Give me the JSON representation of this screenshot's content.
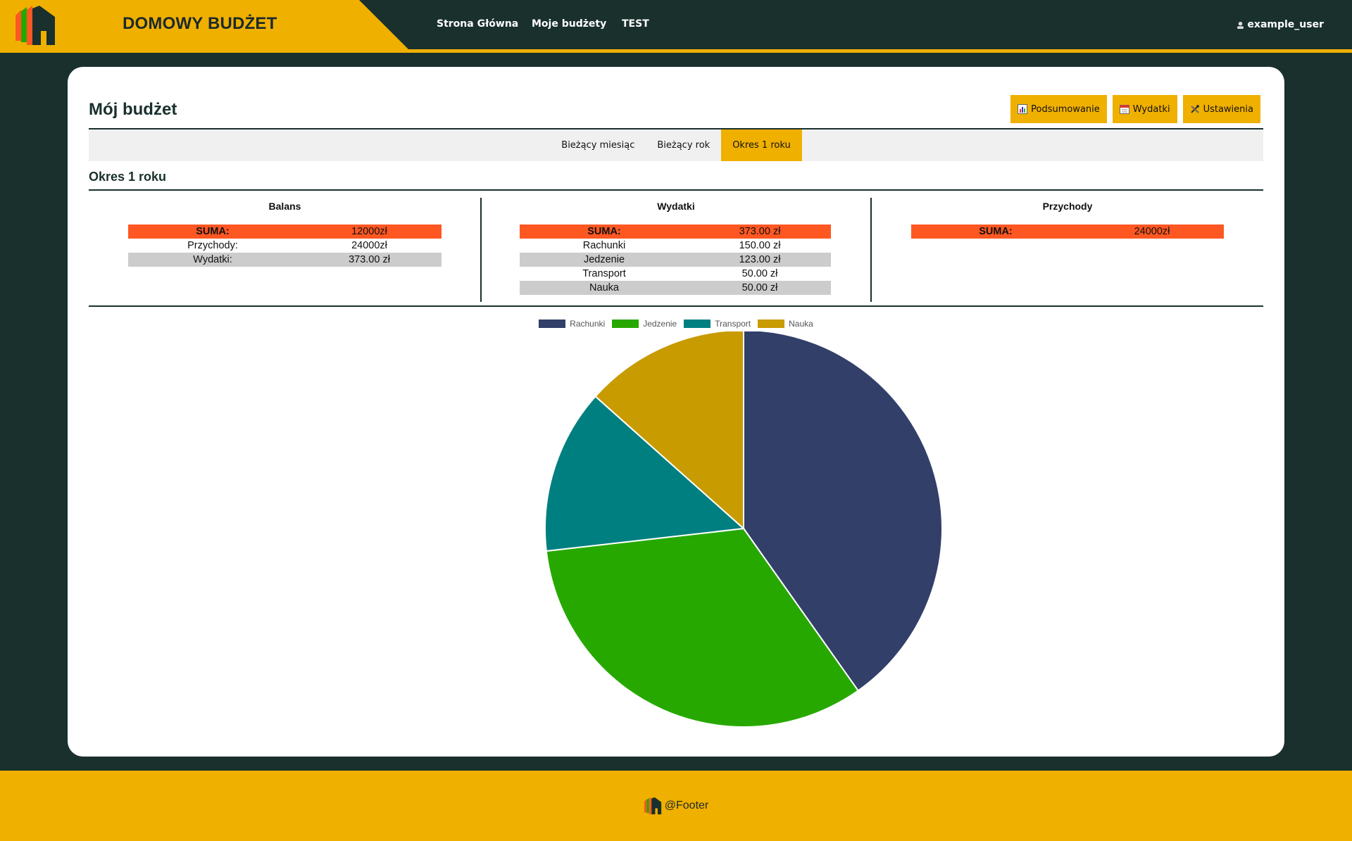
{
  "header": {
    "brand": "DOMOWY BUDŻET",
    "nav": [
      "Strona Główna",
      "Moje budżety",
      "TEST"
    ],
    "user": "example_user"
  },
  "page": {
    "title": "Mój budżet",
    "buttons": {
      "summary": "Podsumowanie",
      "expenses": "Wydatki",
      "settings": "Ustawienia"
    },
    "periods": [
      "Bieżący miesiąc",
      "Bieżący rok",
      "Okres 1 roku"
    ],
    "active_period": "Okres 1 roku",
    "section_title": "Okres 1 roku"
  },
  "balance": {
    "heading": "Balans",
    "rows": [
      {
        "label": "SUMA:",
        "value": "12000zł"
      },
      {
        "label": "Przychody:",
        "value": "24000zł"
      },
      {
        "label": "Wydatki:",
        "value": "373.00 zł"
      }
    ]
  },
  "expenses": {
    "heading": "Wydatki",
    "rows": [
      {
        "label": "SUMA:",
        "value": "373.00 zł"
      },
      {
        "label": "Rachunki",
        "value": "150.00 zł"
      },
      {
        "label": "Jedzenie",
        "value": "123.00 zł"
      },
      {
        "label": "Transport",
        "value": "50.00 zł"
      },
      {
        "label": "Nauka",
        "value": "50.00 zł"
      }
    ]
  },
  "income": {
    "heading": "Przychody",
    "rows": [
      {
        "label": "SUMA:",
        "value": "24000zł"
      }
    ]
  },
  "chart_data": {
    "type": "pie",
    "categories": [
      "Rachunki",
      "Jedzenie",
      "Transport",
      "Nauka"
    ],
    "values": [
      150,
      123,
      50,
      50
    ],
    "colors": [
      "#313f69",
      "#27a800",
      "#007f80",
      "#c89b00"
    ],
    "legend": "top"
  },
  "footer": {
    "text": "@Footer"
  },
  "colors": {
    "accent": "#f0b000",
    "dark": "#19302d",
    "highlight": "#ff5722"
  }
}
